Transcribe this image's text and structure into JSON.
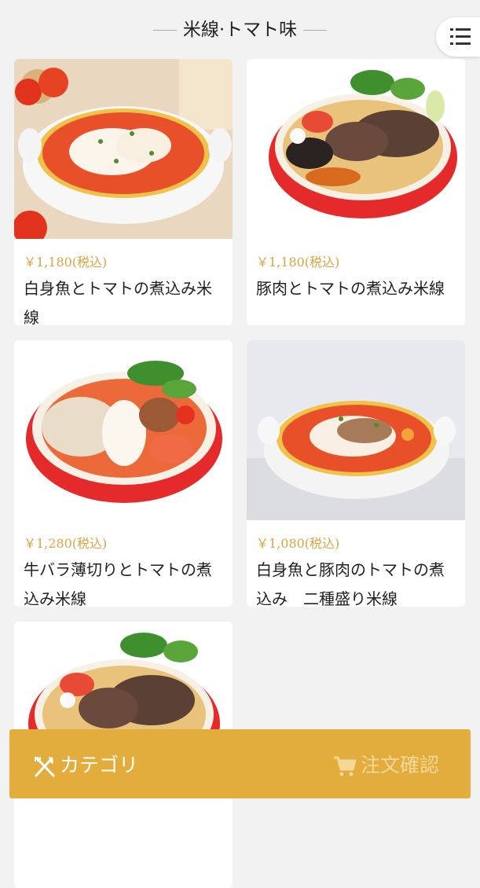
{
  "header": {
    "title": "米線·トマト味"
  },
  "items": [
    {
      "price": "￥1,180(税込)",
      "name": "白身魚とトマトの煮込み米線"
    },
    {
      "price": "￥1,180(税込)",
      "name": "豚肉とトマトの煮込み米線"
    },
    {
      "price": "￥1,280(税込)",
      "name": "牛バラ薄切りとトマトの煮込み米線"
    },
    {
      "price": "￥1,080(税込)",
      "name": "白身魚と豚肉のトマトの煮込み　二種盛り米線"
    },
    {
      "price": "",
      "name": ""
    }
  ],
  "bottom_bar": {
    "category_label": "カテゴリ",
    "order_label": "注文確認"
  },
  "colors": {
    "accent": "#e2ad3d",
    "price": "#d9a441",
    "bowl_red": "#e42a2a",
    "soup": "#e8502a"
  }
}
